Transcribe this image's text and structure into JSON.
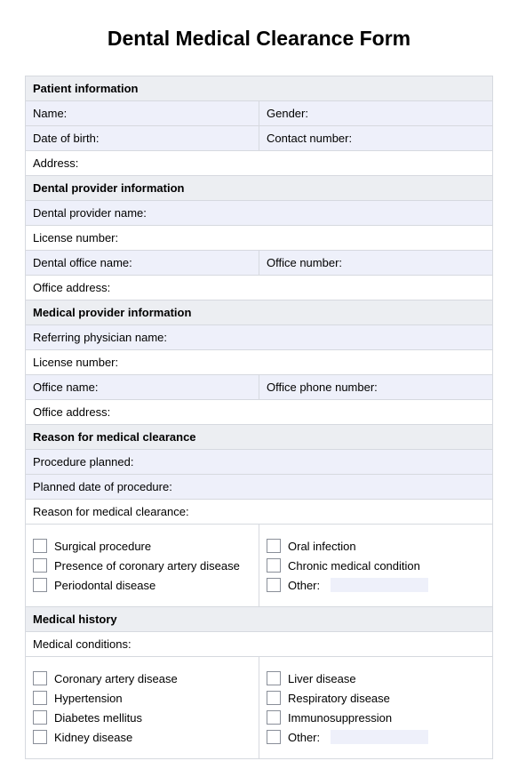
{
  "title": "Dental Medical Clearance Form",
  "sections": {
    "patient": {
      "header": "Patient information",
      "name": "Name:",
      "gender": "Gender:",
      "dob": "Date of birth:",
      "contact": "Contact number:",
      "address": "Address:"
    },
    "dental": {
      "header": "Dental provider information",
      "providerName": "Dental provider name:",
      "license": "License number:",
      "officeName": "Dental office name:",
      "officeNumber": "Office number:",
      "officeAddress": "Office address:"
    },
    "medical": {
      "header": "Medical provider information",
      "physician": "Referring physician name:",
      "license": "License number:",
      "officeName": "Office name:",
      "officePhone": "Office phone number:",
      "officeAddress": "Office address:"
    },
    "reason": {
      "header": "Reason for medical clearance",
      "procedure": "Procedure planned:",
      "plannedDate": "Planned date of procedure:",
      "reasonLabel": "Reason for medical clearance:",
      "checks": {
        "left": [
          "Surgical procedure",
          "Presence of coronary artery disease",
          "Periodontal disease"
        ],
        "right": [
          "Oral infection",
          "Chronic medical condition",
          "Other:"
        ]
      }
    },
    "history": {
      "header": "Medical history",
      "conditionsLabel": "Medical conditions:",
      "checks": {
        "left": [
          "Coronary artery disease",
          "Hypertension",
          "Diabetes mellitus",
          "Kidney disease"
        ],
        "right": [
          "Liver disease",
          "Respiratory disease",
          "Immunosuppression",
          "Other:"
        ]
      }
    }
  }
}
